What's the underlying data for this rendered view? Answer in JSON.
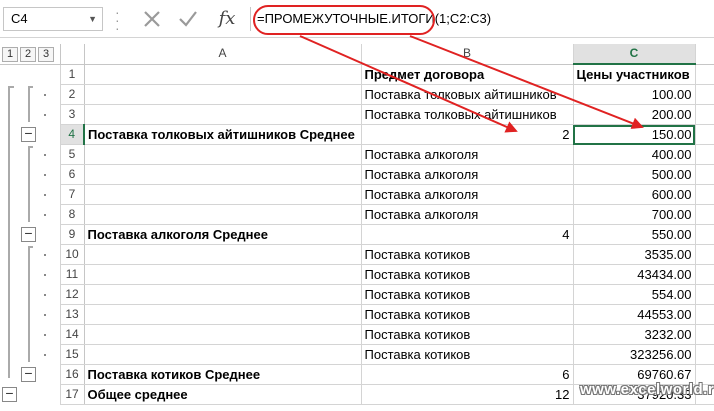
{
  "formula_bar": {
    "name_box": "C4",
    "fx_label": "fx",
    "formula": "=ПРОМЕЖУТОЧНЫЕ.ИТОГИ(1;C2:C3)"
  },
  "outline": {
    "levels": [
      "1",
      "2",
      "3"
    ]
  },
  "columns": [
    "A",
    "B",
    "C"
  ],
  "rows": [
    {
      "n": "1",
      "a": "",
      "b": "Предмет договора",
      "c": "Цены участников"
    },
    {
      "n": "2",
      "a": "",
      "b": "Поставка толковых айтишников",
      "c": "100.00"
    },
    {
      "n": "3",
      "a": "",
      "b": "Поставка толковых айтишников",
      "c": "200.00"
    },
    {
      "n": "4",
      "a": "Поставка толковых айтишников Среднее",
      "b": "2",
      "c": "150.00"
    },
    {
      "n": "5",
      "a": "",
      "b": "Поставка алкоголя",
      "c": "400.00"
    },
    {
      "n": "6",
      "a": "",
      "b": "Поставка алкоголя",
      "c": "500.00"
    },
    {
      "n": "7",
      "a": "",
      "b": "Поставка алкоголя",
      "c": "600.00"
    },
    {
      "n": "8",
      "a": "",
      "b": "Поставка алкоголя",
      "c": "700.00"
    },
    {
      "n": "9",
      "a": "Поставка алкоголя Среднее",
      "b": "4",
      "c": "550.00"
    },
    {
      "n": "10",
      "a": "",
      "b": "Поставка котиков",
      "c": "3535.00"
    },
    {
      "n": "11",
      "a": "",
      "b": "Поставка котиков",
      "c": "43434.00"
    },
    {
      "n": "12",
      "a": "",
      "b": "Поставка котиков",
      "c": "554.00"
    },
    {
      "n": "13",
      "a": "",
      "b": "Поставка котиков",
      "c": "44553.00"
    },
    {
      "n": "14",
      "a": "",
      "b": "Поставка котиков",
      "c": "3232.00"
    },
    {
      "n": "15",
      "a": "",
      "b": "Поставка котиков",
      "c": "323256.00"
    },
    {
      "n": "16",
      "a": "Поставка котиков Среднее",
      "b": "6",
      "c": "69760.67"
    },
    {
      "n": "17",
      "a": "Общее среднее",
      "b": "12",
      "c": "37920.33"
    }
  ],
  "watermark": "www.excelworld.ru",
  "colors": {
    "accent": "#217346",
    "annotation": "#e02222"
  }
}
